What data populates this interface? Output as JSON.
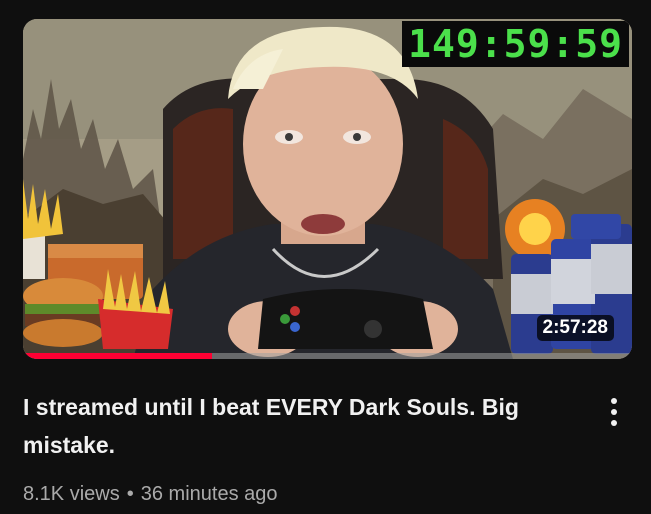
{
  "video": {
    "title": "I streamed until I beat EVERY Dark Souls. Big mistake.",
    "views": "8.1K views",
    "separator": "•",
    "age": "36 minutes ago",
    "duration": "2:57:28",
    "thumbnail_timer": "149:59:59",
    "watch_progress": 0.31,
    "menu_icon": "more-vert-icon"
  },
  "colors": {
    "background": "#0f0f0f",
    "title": "#f1f1f1",
    "meta": "#aaaaaa",
    "progress": "#ff0033",
    "timer": "#4be04b"
  }
}
